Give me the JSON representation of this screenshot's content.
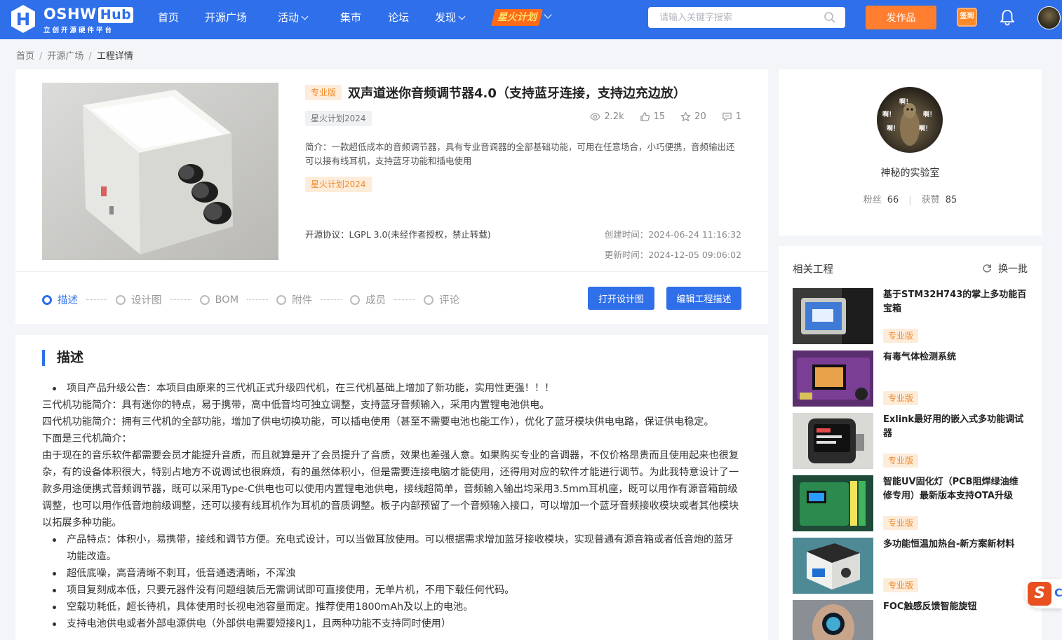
{
  "header": {
    "logo_text": "OSHW",
    "logo_hub": "Hub",
    "logo_sub": "立创开源硬件平台",
    "nav": [
      {
        "label": "首页",
        "has_menu": false
      },
      {
        "label": "开源广场",
        "has_menu": false
      },
      {
        "label": "活动",
        "has_menu": true
      },
      {
        "label": "集市",
        "has_menu": false
      },
      {
        "label": "论坛",
        "has_menu": false
      },
      {
        "label": "发现",
        "has_menu": true
      }
    ],
    "spark_label": "星火计划",
    "search_placeholder": "请输入关键字搜索",
    "publish_label": "发作品",
    "checkin_label": "签到"
  },
  "breadcrumb": [
    "首页",
    "开源广场",
    "工程详情"
  ],
  "project": {
    "edition": "专业版",
    "title": "双声道迷你音频调节器4.0（支持蓝牙连接，支持边充边放）",
    "activity_tag": "星火计划2024",
    "stats": {
      "views": "2.2k",
      "likes": "15",
      "stars": "20",
      "comments": "1"
    },
    "intro": "简介：一款超低成本的音频调节器，具有专业音调器的全部基础功能，可用在任意场合，小巧便携，音频输出还可以接有线耳机，支持蓝牙功能和插电使用",
    "program_tag": "星火计划2024",
    "license": "开源协议：LGPL 3.0(未经作者授权，禁止转载)",
    "created": "创建时间：2024-06-24 11:16:32",
    "updated": "更新时间：2024-12-05 09:06:02",
    "tabs": [
      "描述",
      "设计图",
      "BOM",
      "附件",
      "成员",
      "评论"
    ],
    "open_design_label": "打开设计图",
    "edit_desc_label": "编辑工程描述"
  },
  "description": {
    "heading": "描述",
    "paragraphs": [
      {
        "bullet": true,
        "text": "项目产品升级公告：本项目由原来的三代机正式升级四代机，在三代机基础上增加了新功能，实用性更强！！！"
      },
      {
        "bullet": false,
        "text": "三代机功能简介：具有迷你的特点，易于携带，高中低音均可独立调整，支持蓝牙音频输入，采用内置锂电池供电。"
      },
      {
        "bullet": false,
        "text": "四代机功能简介：拥有三代机的全部功能，增加了供电切换功能，可以插电使用（甚至不需要电池也能工作），优化了蓝牙模块供电电路，保证供电稳定。"
      },
      {
        "bullet": false,
        "text": "下面是三代机简介："
      },
      {
        "bullet": false,
        "text": "由于现在的音乐软件都需要会员才能提升音质，而且就算是开了会员提升了音质，效果也差强人意。如果购买专业的音调器，不仅价格昂贵而且使用起来也很复杂，有的设备体积很大，特别占地方不说调试也很麻烦，有的虽然体积小，但是需要连接电脑才能使用，还得用对应的软件才能进行调节。为此我特意设计了一款多用途便携式音频调节器，既可以采用Type-C供电也可以使用内置锂电池供电，接线超简单，音频输入输出均采用3.5mm耳机座，既可以用作有源音箱前级调整，也可以用作低音炮前级调整，还可以接有线耳机作为耳机的音质调整。板子内部预留了一个音频输入接口，可以增加一个蓝牙音频接收模块或者其他模块以拓展多种功能。"
      },
      {
        "bullet": true,
        "text": "产品特点：体积小，易携带，接线和调节方便。充电式设计，可以当做耳放使用。可以根据需求增加蓝牙接收模块，实现普通有源音箱或者低音炮的蓝牙功能改造。"
      },
      {
        "bullet": true,
        "text": "超低底噪，高音清晰不刺耳，低音通透清晰，不浑浊"
      },
      {
        "bullet": true,
        "text": "项目复刻成本低，只要元器件没有问题组装后无需调试即可直接使用，无单片机，不用下载任何代码。"
      },
      {
        "bullet": true,
        "text": "空载功耗低，超长待机，具体使用时长视电池容量而定。推荐使用1800mAh及以上的电池。"
      },
      {
        "bullet": true,
        "text": "支持电池供电或者外部电源供电（外部供电需要短接RJ1，且两种功能不支持同时使用）"
      }
    ]
  },
  "author": {
    "name": "神秘的实验室",
    "avatar_text": [
      "啊！",
      "啊！",
      "啊！",
      "啊！",
      "啊！"
    ],
    "fans_label": "粉丝",
    "fans": "66",
    "likes_label": "获赞",
    "likes": "85"
  },
  "related": {
    "title": "相关工程",
    "refresh_label": "换一批",
    "items": [
      {
        "name": "基于STM32H743的掌上多功能百宝箱",
        "tag": "专业版"
      },
      {
        "name": "有毒气体检测系统",
        "tag": "专业版"
      },
      {
        "name": "Exlink最好用的嵌入式多功能调试器",
        "tag": "专业版"
      },
      {
        "name": "智能UV固化灯（PCB阻焊绿油维修专用）最新版本支持OTA升级",
        "tag": "专业版"
      },
      {
        "name": "多功能恒温加热台-新方案新材料",
        "tag": "专业版"
      },
      {
        "name": "FOC触感反馈智能旋钮",
        "tag": ""
      }
    ]
  },
  "float_brand": {
    "glyph": "S",
    "side": "C"
  }
}
